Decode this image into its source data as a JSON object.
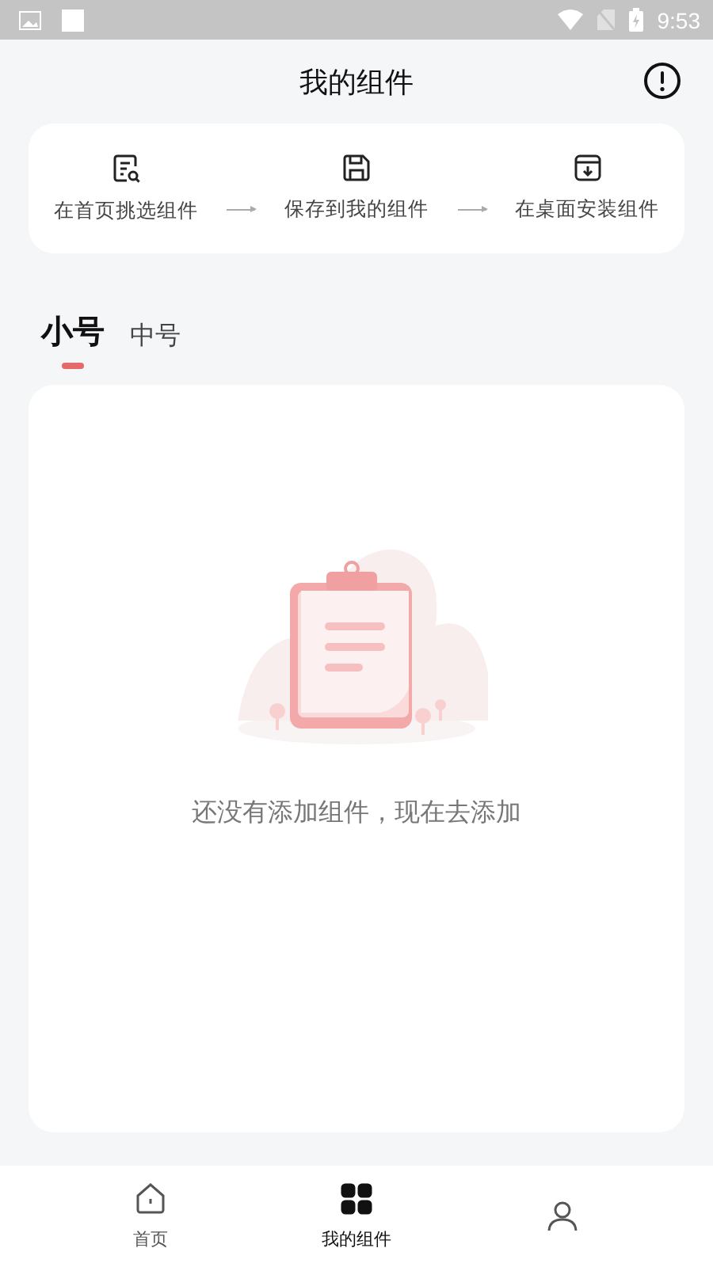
{
  "status_bar": {
    "time": "9:53"
  },
  "header": {
    "title": "我的组件"
  },
  "steps": [
    {
      "label": "在首页挑选组件",
      "kind": "search"
    },
    {
      "label": "保存到我的组件",
      "kind": "save"
    },
    {
      "label": "在桌面安装组件",
      "kind": "install"
    }
  ],
  "tabs": [
    {
      "label": "小号",
      "selected": true
    },
    {
      "label": "中号",
      "selected": false
    }
  ],
  "empty_state": {
    "message": "还没有添加组件，现在去添加"
  },
  "bottom_nav": [
    {
      "label": "首页",
      "kind": "home",
      "selected": false
    },
    {
      "label": "我的组件",
      "kind": "widgets",
      "selected": true
    },
    {
      "kind": "profile",
      "selected": false
    }
  ]
}
